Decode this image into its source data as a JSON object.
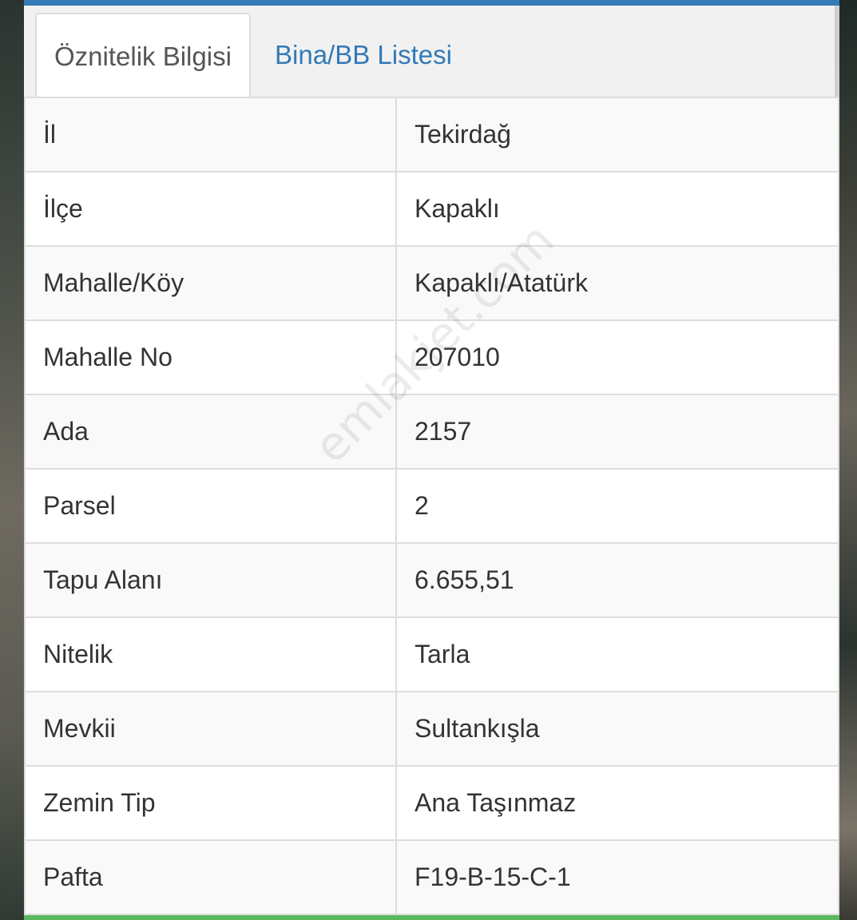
{
  "tabs": {
    "active": "Öznitelik Bilgisi",
    "inactive": "Bina/BB Listesi"
  },
  "rows": [
    {
      "key": "İl",
      "value": "Tekirdağ"
    },
    {
      "key": "İlçe",
      "value": "Kapaklı"
    },
    {
      "key": "Mahalle/Köy",
      "value": "Kapaklı/Atatürk"
    },
    {
      "key": "Mahalle No",
      "value": "207010"
    },
    {
      "key": "Ada",
      "value": "2157"
    },
    {
      "key": "Parsel",
      "value": "2"
    },
    {
      "key": "Tapu Alanı",
      "value": "6.655,51"
    },
    {
      "key": "Nitelik",
      "value": "Tarla"
    },
    {
      "key": "Mevkii",
      "value": "Sultankışla"
    },
    {
      "key": "Zemin Tip",
      "value": "Ana Taşınmaz"
    },
    {
      "key": "Pafta",
      "value": "F19-B-15-C-1"
    }
  ],
  "watermark": "emlakjet.com",
  "colors": {
    "accent": "#337ab7",
    "success": "#5cb85c",
    "border": "#dddddd"
  }
}
